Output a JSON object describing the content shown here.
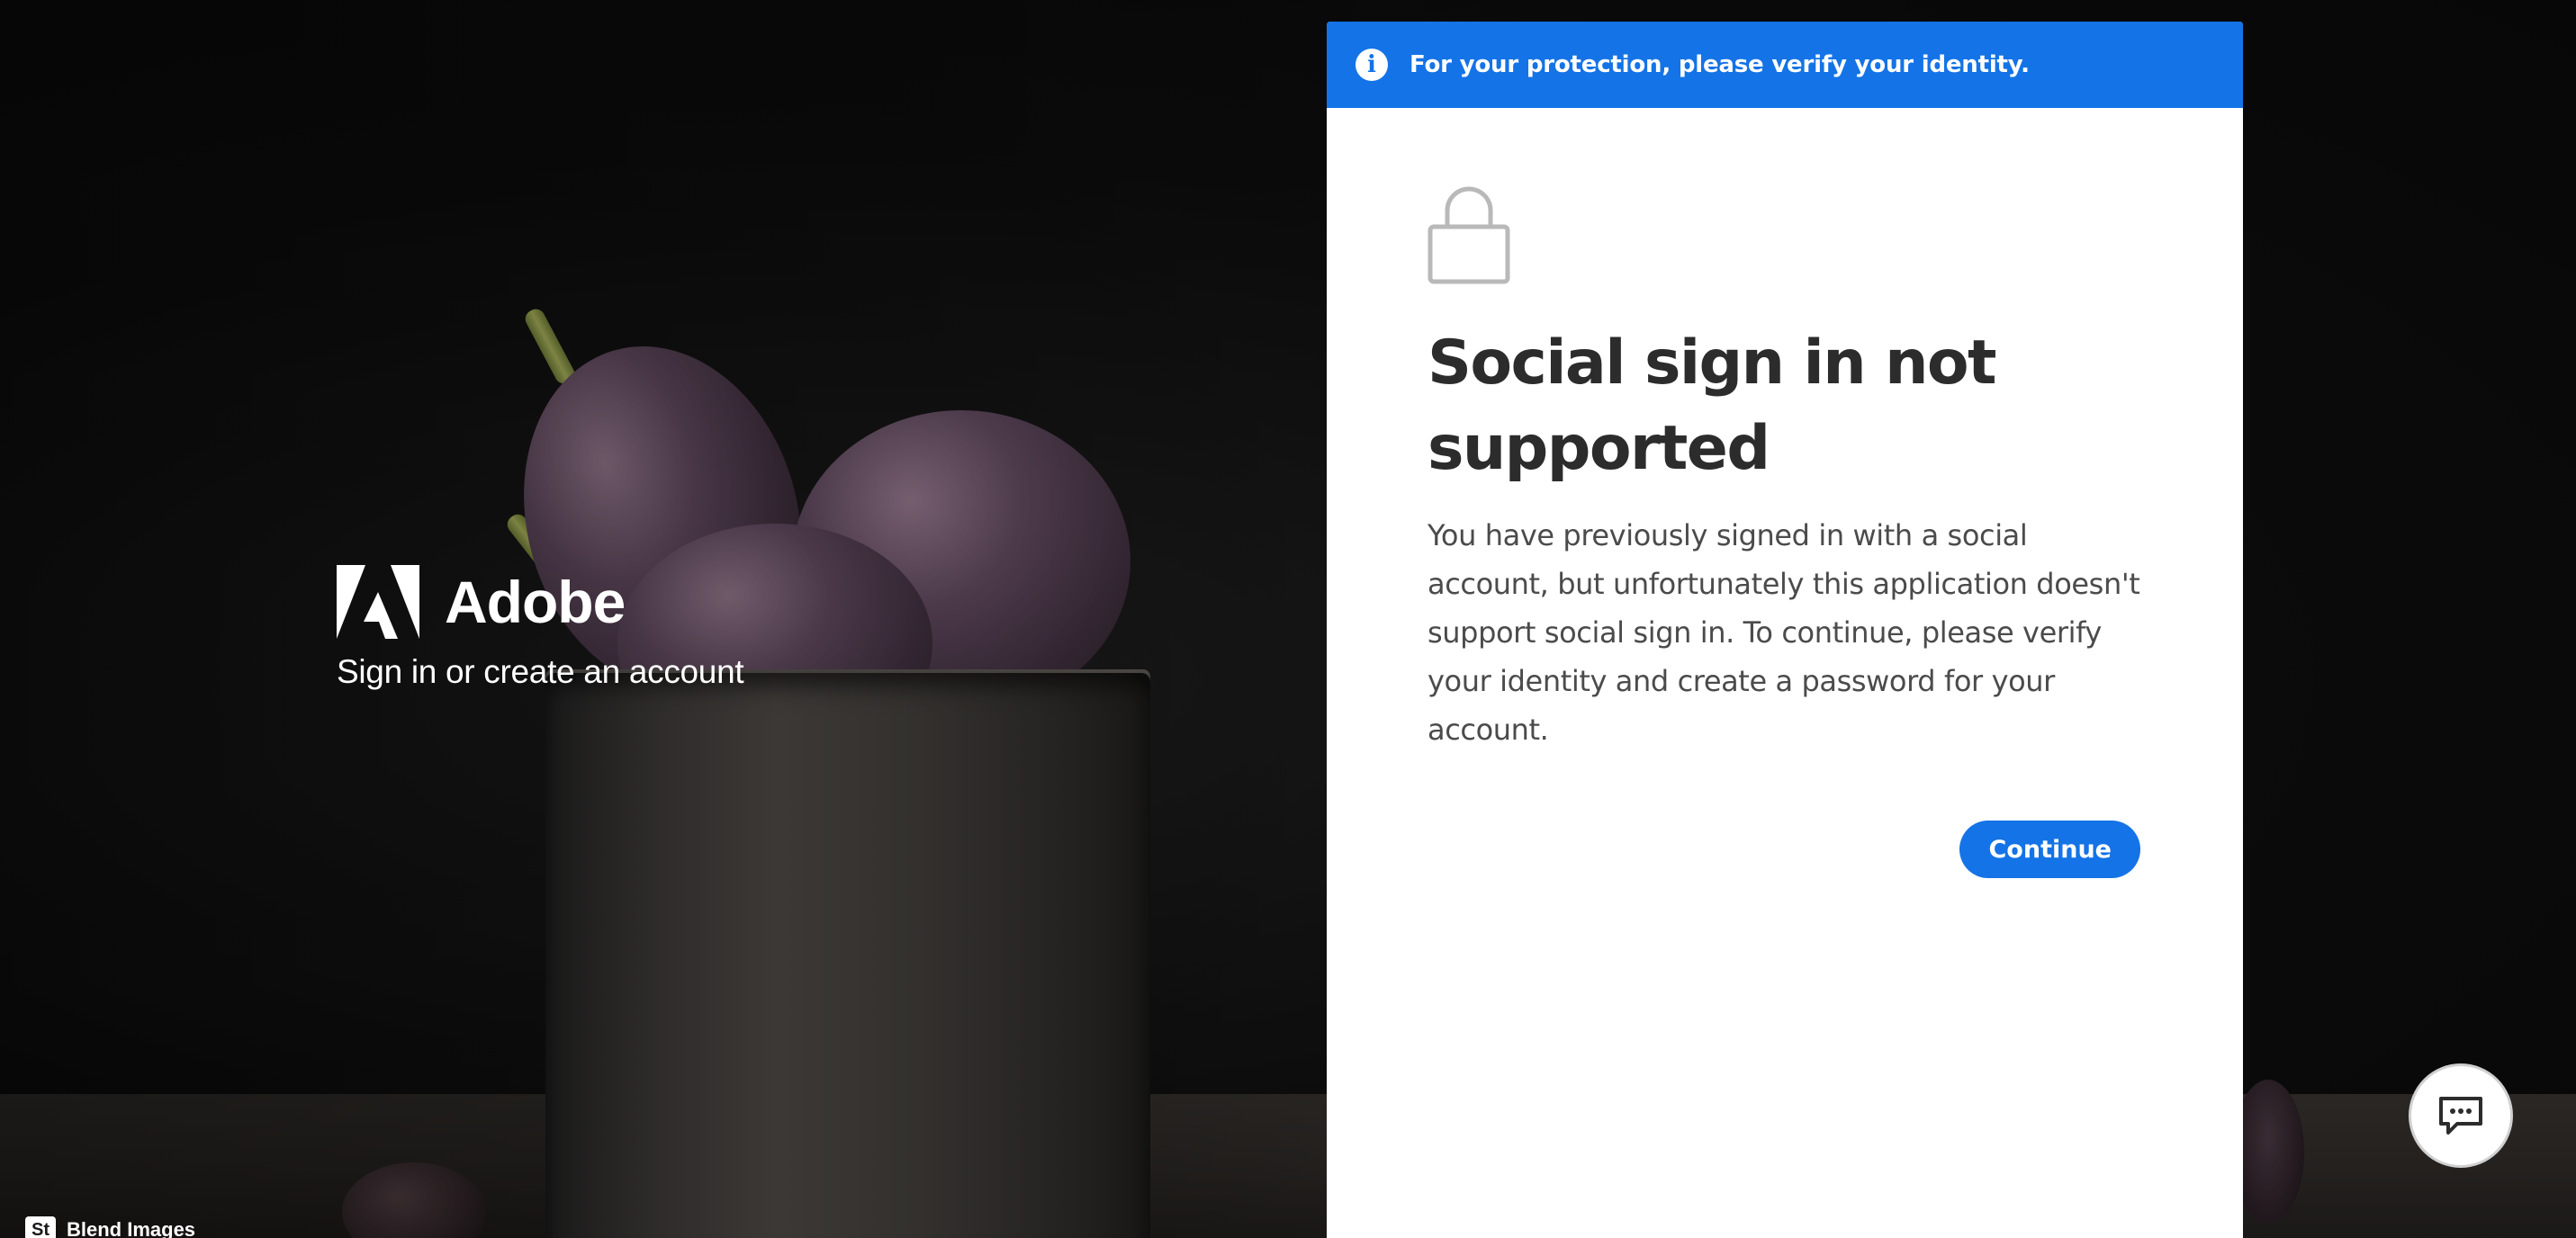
{
  "brand": {
    "name": "Adobe",
    "tagline": "Sign in or create an account",
    "logo_icon": "adobe-logo-icon"
  },
  "banner": {
    "icon": "info-icon",
    "icon_glyph": "i",
    "text": "For your protection, please verify your identity."
  },
  "dialog": {
    "icon": "lock-icon",
    "title": "Social sign in not supported",
    "message": "You have previously signed in with a social account, but unfortunately this application doesn't support social sign in. To continue, please verify your identity and create a password for your account.",
    "continue_label": "Continue"
  },
  "chat": {
    "icon": "chat-icon"
  },
  "credit": {
    "badge": "St",
    "text": "Blend Images"
  },
  "colors": {
    "accent": "#1473e6",
    "card_bg": "#ffffff",
    "title_text": "#2c2c2c",
    "body_text": "#4b4b4b",
    "page_bg": "#0c0c0c"
  }
}
